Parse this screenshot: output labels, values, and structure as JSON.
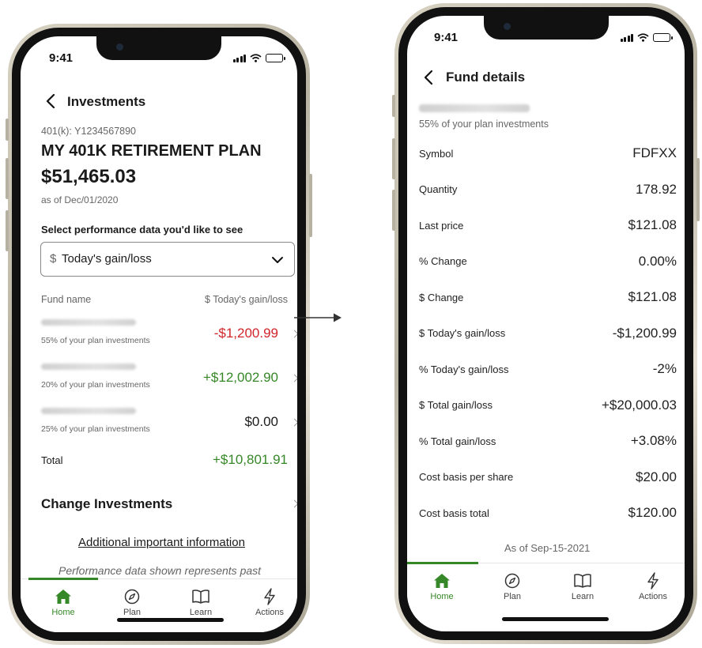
{
  "left_screen": {
    "status_time": "9:41",
    "header_title": "Investments",
    "account_number": "401(k): Y1234567890",
    "plan_name": "MY 401K RETIREMENT PLAN",
    "balance": "$51,465.03",
    "as_of": "as of Dec/01/2020",
    "select_label": "Select performance data you'd like to see",
    "dropdown": {
      "prefix": "$",
      "selected": "Today's gain/loss"
    },
    "table": {
      "col_fund": "Fund name",
      "col_value": "$ Today's gain/loss",
      "rows": [
        {
          "subtitle": "55% of your plan investments",
          "value": "-$1,200.99",
          "status": "negative"
        },
        {
          "subtitle": "20% of your plan investments",
          "value": "+$12,002.90",
          "status": "positive"
        },
        {
          "subtitle": "25% of your plan investments",
          "value": "$0.00",
          "status": "neutral"
        }
      ],
      "total_label": "Total",
      "total_value": "+$10,801.91"
    },
    "change_investments": "Change Investments",
    "additional_info": "Additional important information",
    "performance_note": "Performance data shown represents past"
  },
  "right_screen": {
    "status_time": "9:41",
    "header_title": "Fund details",
    "fund_subtitle": "55% of your plan investments",
    "details": [
      {
        "label": "Symbol",
        "value": "FDFXX",
        "status": "neutral"
      },
      {
        "label": "Quantity",
        "value": "178.92",
        "status": "neutral"
      },
      {
        "label": "Last price",
        "value": "$121.08",
        "status": "neutral"
      },
      {
        "label": "% Change",
        "value": "0.00%",
        "status": "neutral"
      },
      {
        "label": "$ Change",
        "value": "$121.08",
        "status": "neutral"
      },
      {
        "label": "$ Today's gain/loss",
        "value": "-$1,200.99",
        "status": "negative"
      },
      {
        "label": "% Today's gain/loss",
        "value": "-2%",
        "status": "negative"
      },
      {
        "label": "$ Total gain/loss",
        "value": "+$20,000.03",
        "status": "positive"
      },
      {
        "label": "% Total gain/loss",
        "value": "+3.08%",
        "status": "positive"
      },
      {
        "label": "Cost basis per share",
        "value": "$20.00",
        "status": "neutral"
      },
      {
        "label": "Cost basis total",
        "value": "$120.00",
        "status": "neutral"
      }
    ],
    "as_of": "As of Sep-15-2021"
  },
  "tabs": [
    {
      "label": "Home",
      "icon": "home-icon",
      "active": true
    },
    {
      "label": "Plan",
      "icon": "compass-icon",
      "active": false
    },
    {
      "label": "Learn",
      "icon": "book-icon",
      "active": false
    },
    {
      "label": "Actions",
      "icon": "lightning-icon",
      "active": false
    }
  ],
  "colors": {
    "positive": "#368727",
    "negative": "#d1242a",
    "accent": "#368727"
  }
}
